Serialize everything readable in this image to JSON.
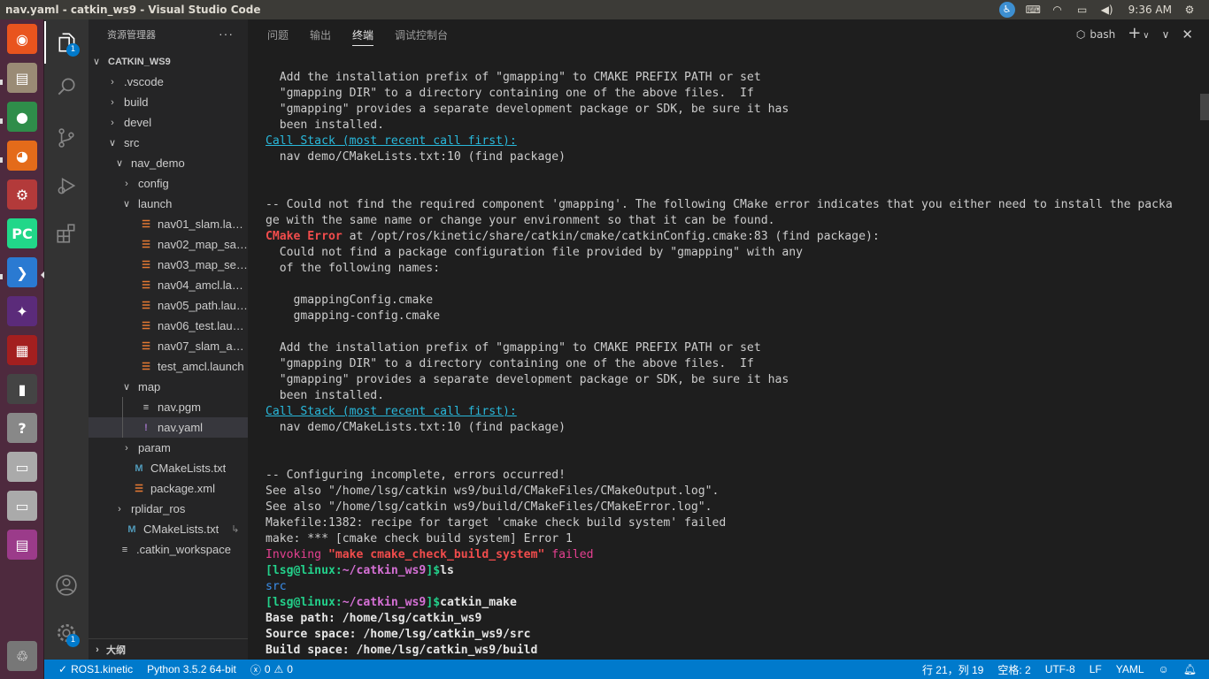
{
  "window_title": "nav.yaml - catkin_ws9 - Visual Studio Code",
  "clock": "9:36 AM",
  "launcher": [
    {
      "name": "ubuntu-dash",
      "color": "#e9541e",
      "glyph": "◉"
    },
    {
      "name": "files",
      "color": "#9a8b75",
      "glyph": "▤"
    },
    {
      "name": "chrome",
      "color": "#2f8d4a",
      "glyph": "●"
    },
    {
      "name": "firefox",
      "color": "#e46b1a",
      "glyph": "◕"
    },
    {
      "name": "system-settings",
      "color": "#b33a3a",
      "glyph": "⚙"
    },
    {
      "name": "pycharm",
      "color": "#21d789",
      "glyph": "PC"
    },
    {
      "name": "vscode",
      "color": "#2a7ad2",
      "glyph": "❯"
    },
    {
      "name": "app-purple",
      "color": "#5b2b7a",
      "glyph": "✦"
    },
    {
      "name": "app-red",
      "color": "#a31f1f",
      "glyph": "▦"
    },
    {
      "name": "terminal",
      "color": "#444444",
      "glyph": "▮"
    },
    {
      "name": "help",
      "color": "#888888",
      "glyph": "?"
    },
    {
      "name": "disk-1",
      "color": "#aaaaaa",
      "glyph": "▭"
    },
    {
      "name": "disk-2",
      "color": "#aaaaaa",
      "glyph": "▭"
    },
    {
      "name": "app-window",
      "color": "#9b3b8a",
      "glyph": "▤"
    },
    {
      "name": "trash",
      "color": "#777777",
      "glyph": "♲"
    }
  ],
  "activity": {
    "explorer_badge": "1",
    "settings_badge": "1"
  },
  "sidebar": {
    "header": "资源管理器",
    "more": "···",
    "outline": "大纲",
    "tree": [
      {
        "label": "CATKIN_WS9",
        "depth": 0,
        "chev": "∨",
        "icon": "",
        "root": true
      },
      {
        "label": ".vscode",
        "depth": 1,
        "chev": "›",
        "icon": ""
      },
      {
        "label": "build",
        "depth": 1,
        "chev": "›",
        "icon": ""
      },
      {
        "label": "devel",
        "depth": 1,
        "chev": "›",
        "icon": ""
      },
      {
        "label": "src",
        "depth": 1,
        "chev": "∨",
        "icon": ""
      },
      {
        "label": "nav_demo",
        "depth": 2,
        "chev": "∨",
        "icon": ""
      },
      {
        "label": "config",
        "depth": 3,
        "chev": "›",
        "icon": ""
      },
      {
        "label": "launch",
        "depth": 3,
        "chev": "∨",
        "icon": ""
      },
      {
        "label": "nav01_slam.launch",
        "depth": 4,
        "chev": "",
        "icon": "rss"
      },
      {
        "label": "nav02_map_sav...",
        "depth": 4,
        "chev": "",
        "icon": "rss"
      },
      {
        "label": "nav03_map_serv...",
        "depth": 4,
        "chev": "",
        "icon": "rss"
      },
      {
        "label": "nav04_amcl.launch",
        "depth": 4,
        "chev": "",
        "icon": "rss"
      },
      {
        "label": "nav05_path.launch",
        "depth": 4,
        "chev": "",
        "icon": "rss"
      },
      {
        "label": "nav06_test.launch",
        "depth": 4,
        "chev": "",
        "icon": "rss"
      },
      {
        "label": "nav07_slam_aut...",
        "depth": 4,
        "chev": "",
        "icon": "rss"
      },
      {
        "label": "test_amcl.launch",
        "depth": 4,
        "chev": "",
        "icon": "rss"
      },
      {
        "label": "map",
        "depth": 3,
        "chev": "∨",
        "icon": ""
      },
      {
        "label": "nav.pgm",
        "depth": 4,
        "chev": "",
        "icon": "lines"
      },
      {
        "label": "nav.yaml",
        "depth": 4,
        "chev": "",
        "icon": "yaml",
        "selected": true
      },
      {
        "label": "param",
        "depth": 3,
        "chev": "›",
        "icon": ""
      },
      {
        "label": "CMakeLists.txt",
        "depth": 3,
        "chev": "",
        "icon": "cmake"
      },
      {
        "label": "package.xml",
        "depth": 3,
        "chev": "",
        "icon": "rss"
      },
      {
        "label": "rplidar_ros",
        "depth": 2,
        "chev": "›",
        "icon": ""
      },
      {
        "label": "CMakeLists.txt",
        "depth": 2,
        "chev": "",
        "icon": "cmake",
        "suffix": "↳"
      },
      {
        "label": ".catkin_workspace",
        "depth": 1,
        "chev": "",
        "icon": "lines"
      }
    ]
  },
  "panel": {
    "tabs": [
      "问题",
      "输出",
      "终端",
      "调试控制台"
    ],
    "active_tab": 2,
    "terminal_name": "bash",
    "add": "+",
    "chevron": "∨",
    "close": "∨"
  },
  "terminal_lines": [
    [
      {
        "t": "  Add the installation prefix of \"gmapping\" to CMAKE PREFIX PATH or set"
      }
    ],
    [
      {
        "t": "  \"gmapping DIR\" to a directory containing one of the above files.  If"
      }
    ],
    [
      {
        "t": "  \"gmapping\" provides a separate development package or SDK, be sure it has"
      }
    ],
    [
      {
        "t": "  been installed."
      }
    ],
    [
      {
        "t": "Call Stack (most recent call first):",
        "c": "cyan-link"
      }
    ],
    [
      {
        "t": "  nav demo/CMakeLists.txt:10 (find package)"
      }
    ],
    [
      {
        "t": ""
      }
    ],
    [
      {
        "t": ""
      }
    ],
    [
      {
        "t": "-- Could not find the required component 'gmapping'. The following CMake error indicates that you either need to install the packa"
      }
    ],
    [
      {
        "t": "ge with the same name or change your environment so that it can be found."
      }
    ],
    [
      {
        "t": "CMake Error",
        "c": "err-bold"
      },
      {
        "t": " at /opt/ros/kinetic/share/catkin/cmake/catkinConfig.cmake:83 (find package):"
      }
    ],
    [
      {
        "t": "  Could not find a package configuration file provided by \"gmapping\" with any"
      }
    ],
    [
      {
        "t": "  of the following names:"
      }
    ],
    [
      {
        "t": ""
      }
    ],
    [
      {
        "t": "    gmappingConfig.cmake"
      }
    ],
    [
      {
        "t": "    gmapping-config.cmake"
      }
    ],
    [
      {
        "t": ""
      }
    ],
    [
      {
        "t": "  Add the installation prefix of \"gmapping\" to CMAKE PREFIX PATH or set"
      }
    ],
    [
      {
        "t": "  \"gmapping DIR\" to a directory containing one of the above files.  If"
      }
    ],
    [
      {
        "t": "  \"gmapping\" provides a separate development package or SDK, be sure it has"
      }
    ],
    [
      {
        "t": "  been installed."
      }
    ],
    [
      {
        "t": "Call Stack (most recent call first):",
        "c": "cyan-link"
      }
    ],
    [
      {
        "t": "  nav demo/CMakeLists.txt:10 (find package)"
      }
    ],
    [
      {
        "t": ""
      }
    ],
    [
      {
        "t": ""
      }
    ],
    [
      {
        "t": "-- Configuring incomplete, errors occurred!"
      }
    ],
    [
      {
        "t": "See also \"/home/lsg/catkin ws9/build/CMakeFiles/CMakeOutput.log\"."
      }
    ],
    [
      {
        "t": "See also \"/home/lsg/catkin ws9/build/CMakeFiles/CMakeError.log\"."
      }
    ],
    [
      {
        "t": "Makefile:1382: recipe for target 'cmake check build system' failed"
      }
    ],
    [
      {
        "t": "make: *** [cmake check build system] Error 1"
      }
    ],
    [
      {
        "t": "Invoking ",
        "c": "pink"
      },
      {
        "t": "\"make cmake_check_build_system\"",
        "c": "err-bold"
      },
      {
        "t": " failed",
        "c": "pink"
      }
    ],
    [
      {
        "t": "[lsg@linux:",
        "c": "green"
      },
      {
        "t": "~/catkin_ws9",
        "c": "magenta"
      },
      {
        "t": "]$",
        "c": "green"
      },
      {
        "t": "ls",
        "c": "bold"
      }
    ],
    [
      {
        "t": "src",
        "c": "blue"
      }
    ],
    [
      {
        "t": "[lsg@linux:",
        "c": "green"
      },
      {
        "t": "~/catkin_ws9",
        "c": "magenta"
      },
      {
        "t": "]$",
        "c": "green"
      },
      {
        "t": "catkin_make",
        "c": "bold"
      }
    ],
    [
      {
        "t": "Base path: /home/lsg/catkin_ws9",
        "c": "bold"
      }
    ],
    [
      {
        "t": "Source space: /home/lsg/catkin_ws9/src",
        "c": "bold"
      }
    ],
    [
      {
        "t": "Build space: /home/lsg/catkin_ws9/build",
        "c": "bold"
      }
    ]
  ],
  "statusbar": {
    "remote": "ROS1.kinetic",
    "python": "Python 3.5.2 64-bit",
    "errors": "0",
    "warnings": "0",
    "position": "行 21，列 19",
    "spaces": "空格: 2",
    "encoding": "UTF-8",
    "eol": "LF",
    "language": "YAML"
  },
  "colors": {
    "accent": "#007acc",
    "launcher_bg": "#4e2a3e",
    "error": "#f14c4c"
  }
}
